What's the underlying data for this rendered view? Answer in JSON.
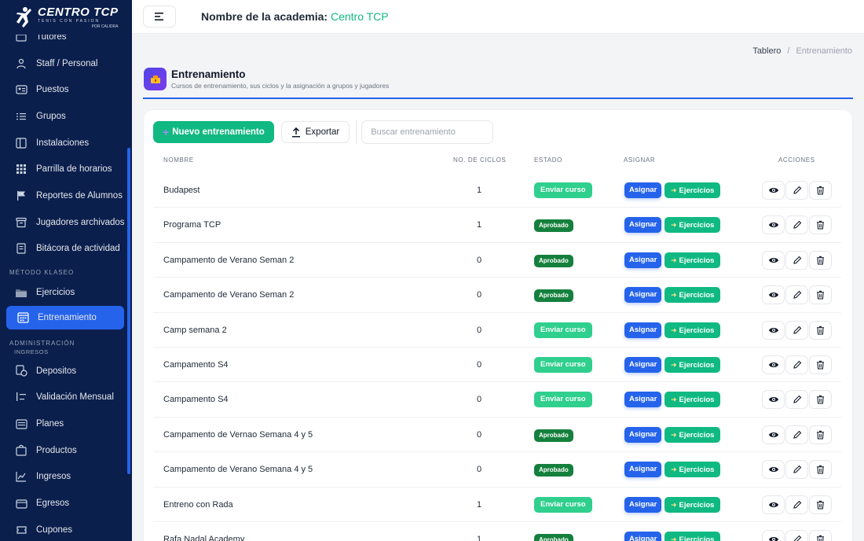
{
  "brand": {
    "name": "CENTRO TCP",
    "tagline": "TENIS CON PASION",
    "by": "POR CALIDRA"
  },
  "sidebar": {
    "items_top": [
      {
        "label": "Tutores",
        "icon": "users-icon"
      },
      {
        "label": "Staff / Personal",
        "icon": "person-icon"
      },
      {
        "label": "Puestos",
        "icon": "id-card-icon"
      },
      {
        "label": "Grupos",
        "icon": "list-icon"
      },
      {
        "label": "Instalaciones",
        "icon": "panel-icon"
      },
      {
        "label": "Parrilla de horarios",
        "icon": "grid-icon"
      },
      {
        "label": "Reportes de Alumnos",
        "icon": "flag-icon"
      },
      {
        "label": "Jugadores archivados",
        "icon": "archive-icon"
      },
      {
        "label": "Bitácora de actividad",
        "icon": "log-icon"
      }
    ],
    "section_metodo": "MÉTODO KLASEO",
    "items_metodo": [
      {
        "label": "Ejercicios",
        "icon": "folder-icon"
      },
      {
        "label": "Entrenamiento",
        "icon": "calendar-icon"
      }
    ],
    "section_admin": "ADMINISTRACIÓN",
    "sub_ingresos": "INGRESOS",
    "items_admin": [
      {
        "label": "Depositos",
        "icon": "deposit-icon"
      },
      {
        "label": "Validación Mensual",
        "icon": "check-list-icon"
      },
      {
        "label": "Planes",
        "icon": "card-icon"
      },
      {
        "label": "Productos",
        "icon": "bag-icon"
      },
      {
        "label": "Ingresos",
        "icon": "chart-icon"
      },
      {
        "label": "Egresos",
        "icon": "wallet-icon"
      },
      {
        "label": "Cupones",
        "icon": "ticket-icon"
      }
    ]
  },
  "topbar": {
    "academy_label": "Nombre de la academia:",
    "academy_value": "Centro TCP"
  },
  "breadcrumb": {
    "home": "Tablero",
    "separator": "/",
    "current": "Entrenamiento"
  },
  "page": {
    "title": "Entrenamiento",
    "subtitle": "Cursos de entrenamiento, sus ciclos y la asignación a grupos y jugadores"
  },
  "toolbar": {
    "new_label": "Nuevo entrenamiento",
    "export_label": "Exportar",
    "search_placeholder": "Buscar entrenamiento"
  },
  "table": {
    "headers": {
      "name": "NOMBRE",
      "cycles": "NO. DE CICLOS",
      "status": "ESTADO",
      "assign": "ASIGNAR",
      "actions": "ACCIONES"
    },
    "assign_label": "Asignar",
    "exercises_label": "Ejercicios",
    "rows": [
      {
        "name": "Budapest",
        "cycles": "1",
        "status": "Enviar curso",
        "status_type": "send"
      },
      {
        "name": "Programa TCP",
        "cycles": "1",
        "status": "Aprobado",
        "status_type": "approved"
      },
      {
        "name": "Campamento de Verano Seman 2",
        "cycles": "0",
        "status": "Aprobado",
        "status_type": "approved"
      },
      {
        "name": "Campamento de Verano Seman 2",
        "cycles": "0",
        "status": "Aprobado",
        "status_type": "approved"
      },
      {
        "name": "Camp semana 2",
        "cycles": "0",
        "status": "Enviar curso",
        "status_type": "send"
      },
      {
        "name": "Campamento S4",
        "cycles": "0",
        "status": "Enviar curso",
        "status_type": "send"
      },
      {
        "name": "Campamento S4",
        "cycles": "0",
        "status": "Enviar curso",
        "status_type": "send"
      },
      {
        "name": "Campamento de Vernao Semana 4 y 5",
        "cycles": "0",
        "status": "Aprobado",
        "status_type": "approved"
      },
      {
        "name": "Campamento de Verano Semana 4 y 5",
        "cycles": "0",
        "status": "Aprobado",
        "status_type": "approved"
      },
      {
        "name": "Entreno con Rada",
        "cycles": "1",
        "status": "Enviar curso",
        "status_type": "send"
      },
      {
        "name": "Rafa Nadal Academy",
        "cycles": "1",
        "status": "Aprobado",
        "status_type": "approved"
      }
    ]
  },
  "colors": {
    "sidebar_bg": "#0b1f4d",
    "accent_blue": "#2563eb",
    "accent_green": "#10b981",
    "approved_green": "#15803d"
  }
}
